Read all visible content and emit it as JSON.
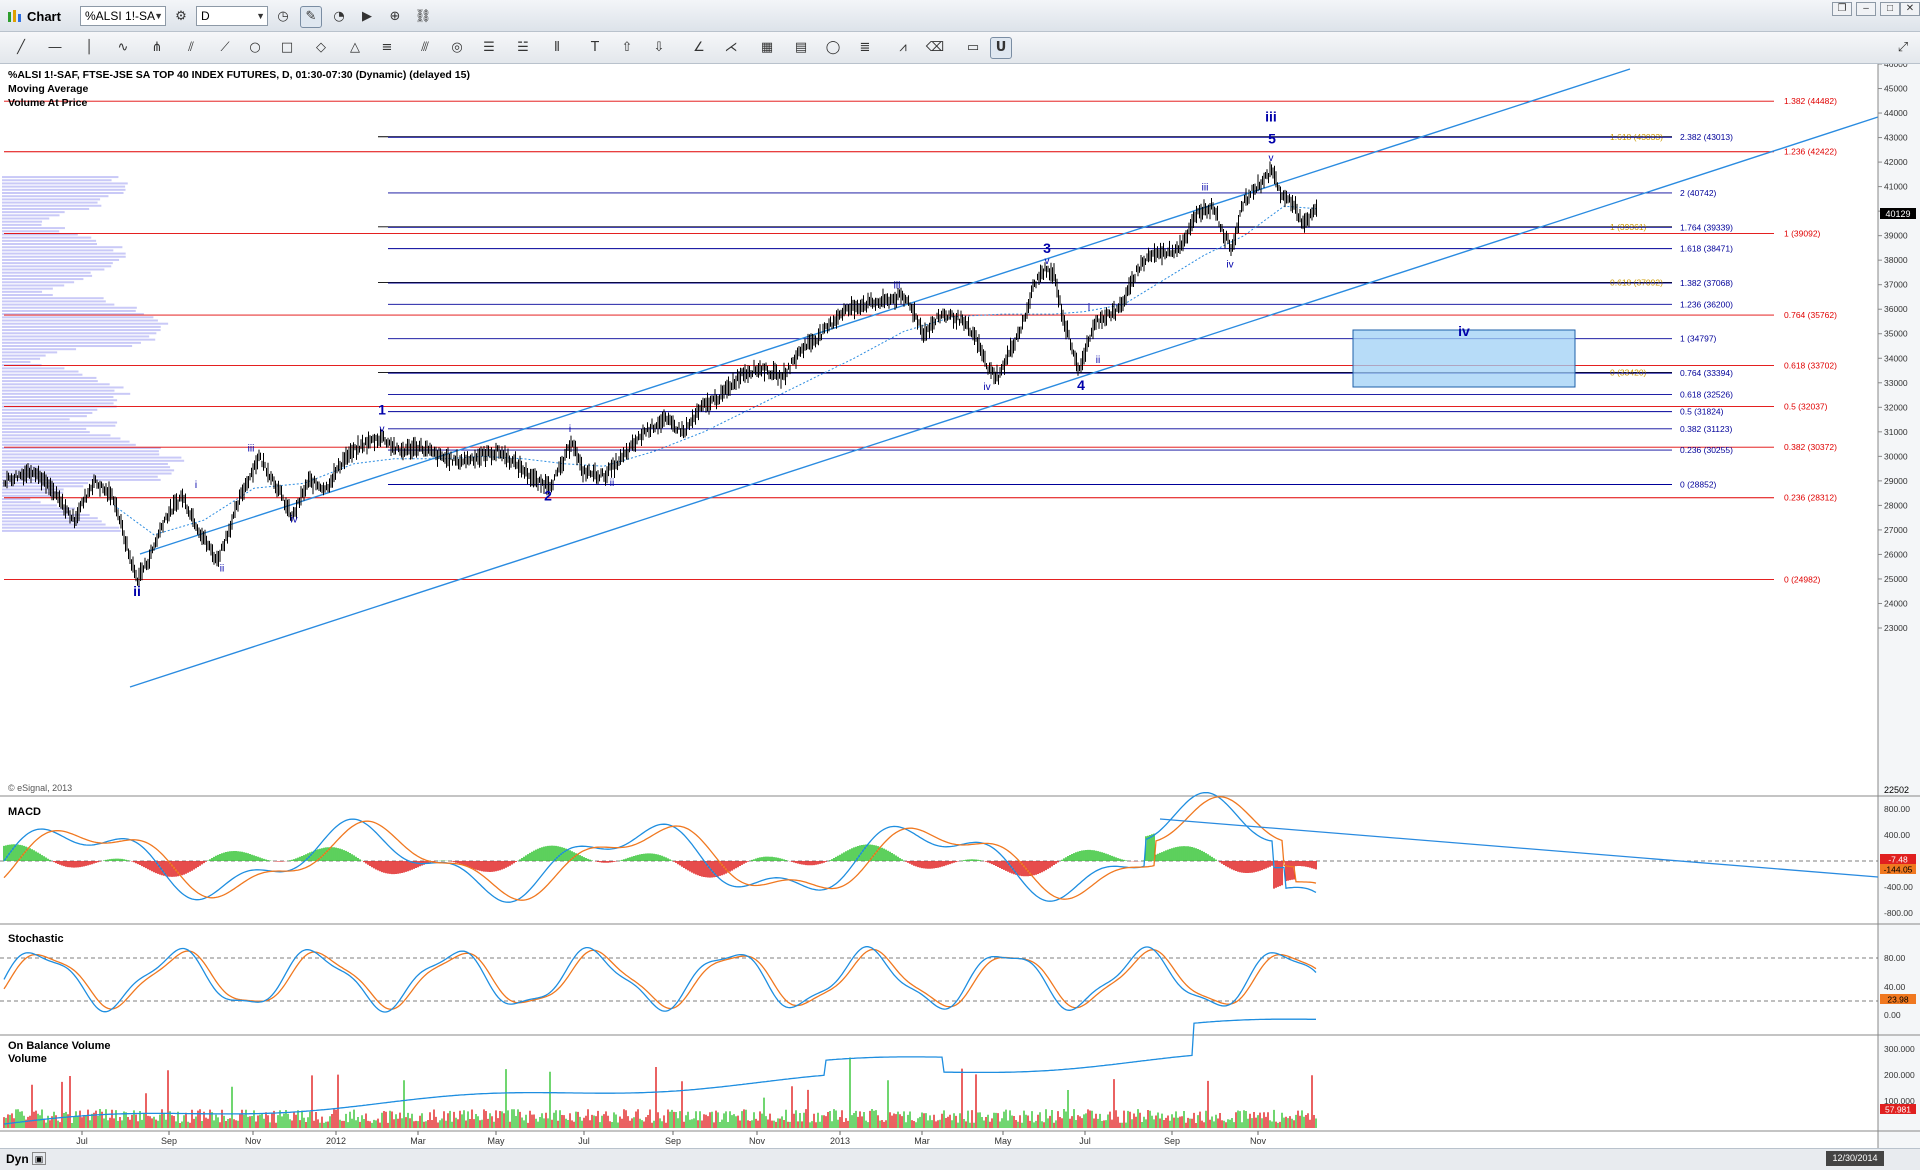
{
  "window": {
    "title": "Chart",
    "symbol": "%ALSI 1!-SA",
    "interval": "D"
  },
  "chart_info": {
    "line1": "%ALSI 1!-SAF, FTSE-JSE SA TOP 40 INDEX FUTURES, D, 01:30-07:30 (Dynamic) (delayed 15)",
    "line2": "Moving Average",
    "line3": "Volume At Price"
  },
  "copyright": "© eSignal, 2013",
  "statusbar": {
    "left": "Dyn",
    "date_box": "12/30/2014"
  },
  "colors": {
    "price": "#000000",
    "macd_line": "#1e8ee0",
    "signal_line": "#f07820",
    "hist_up": "#34c434",
    "hist_down": "#e02020",
    "fib_red": "#e00000",
    "fib_blue": "#000099",
    "fib_gold": "#cc9900",
    "channel": "#2a8be0",
    "box_fill": "#9fd0f5"
  },
  "chart_data": {
    "type": "line",
    "title": "",
    "x_ticks": [
      "Jul",
      "Sep",
      "Nov",
      "2012",
      "Mar",
      "May",
      "Jul",
      "Sep",
      "Nov",
      "2013",
      "Mar",
      "May",
      "Jul",
      "Sep",
      "Nov"
    ],
    "price_axis": {
      "ylim": [
        22000,
        46500
      ],
      "ticks": [
        "46000",
        "45000",
        "44000",
        "43000",
        "42000",
        "41000",
        "40000",
        "39000",
        "38000",
        "37000",
        "36000",
        "35000",
        "34000",
        "33000",
        "32000",
        "31000",
        "30000",
        "29000",
        "28000",
        "27000",
        "26000",
        "25000",
        "24000",
        "23000"
      ],
      "last_value": "40129",
      "bottom_value": "22502"
    },
    "price_series": [
      [
        0,
        29000
      ],
      [
        30,
        29450
      ],
      [
        50,
        28500
      ],
      [
        70,
        27400
      ],
      [
        90,
        29000
      ],
      [
        110,
        28300
      ],
      [
        125,
        26000
      ],
      [
        133,
        24980
      ],
      [
        145,
        25800
      ],
      [
        160,
        27400
      ],
      [
        178,
        28400
      ],
      [
        195,
        27000
      ],
      [
        213,
        25750
      ],
      [
        225,
        27000
      ],
      [
        238,
        28500
      ],
      [
        255,
        30000
      ],
      [
        270,
        29000
      ],
      [
        288,
        27500
      ],
      [
        305,
        29000
      ],
      [
        322,
        28700
      ],
      [
        340,
        29900
      ],
      [
        360,
        30500
      ],
      [
        378,
        30800
      ],
      [
        395,
        30200
      ],
      [
        415,
        30400
      ],
      [
        435,
        30000
      ],
      [
        455,
        29800
      ],
      [
        475,
        30000
      ],
      [
        495,
        30200
      ],
      [
        515,
        29600
      ],
      [
        535,
        28900
      ],
      [
        548,
        28900
      ],
      [
        560,
        29800
      ],
      [
        568,
        30700
      ],
      [
        578,
        29400
      ],
      [
        600,
        29200
      ],
      [
        620,
        30000
      ],
      [
        640,
        31000
      ],
      [
        660,
        31500
      ],
      [
        680,
        31000
      ],
      [
        698,
        32000
      ],
      [
        718,
        32500
      ],
      [
        738,
        33400
      ],
      [
        758,
        33600
      ],
      [
        778,
        33200
      ],
      [
        798,
        34400
      ],
      [
        818,
        35000
      ],
      [
        838,
        35900
      ],
      [
        858,
        36200
      ],
      [
        878,
        36300
      ],
      [
        896,
        36500
      ],
      [
        905,
        36300
      ],
      [
        920,
        35000
      ],
      [
        938,
        35800
      ],
      [
        956,
        35600
      ],
      [
        972,
        34800
      ],
      [
        985,
        33500
      ],
      [
        995,
        33250
      ],
      [
        1005,
        34200
      ],
      [
        1020,
        35500
      ],
      [
        1030,
        37000
      ],
      [
        1040,
        37600
      ],
      [
        1050,
        37400
      ],
      [
        1060,
        35500
      ],
      [
        1068,
        34500
      ],
      [
        1076,
        33400
      ],
      [
        1083,
        34600
      ],
      [
        1093,
        35500
      ],
      [
        1103,
        35800
      ],
      [
        1113,
        35900
      ],
      [
        1123,
        36600
      ],
      [
        1133,
        37600
      ],
      [
        1145,
        38200
      ],
      [
        1158,
        38300
      ],
      [
        1170,
        38400
      ],
      [
        1180,
        38800
      ],
      [
        1195,
        40000
      ],
      [
        1210,
        40200
      ],
      [
        1220,
        39000
      ],
      [
        1228,
        38500
      ],
      [
        1238,
        40200
      ],
      [
        1248,
        40800
      ],
      [
        1258,
        41200
      ],
      [
        1268,
        41650
      ],
      [
        1278,
        40600
      ],
      [
        1288,
        40400
      ],
      [
        1300,
        39400
      ],
      [
        1313,
        40129
      ]
    ],
    "moving_average": [
      [
        110,
        28000
      ],
      [
        150,
        26800
      ],
      [
        200,
        27400
      ],
      [
        250,
        28700
      ],
      [
        300,
        28900
      ],
      [
        350,
        29700
      ],
      [
        390,
        29900
      ],
      [
        440,
        29900
      ],
      [
        480,
        30000
      ],
      [
        520,
        29900
      ],
      [
        560,
        29700
      ],
      [
        600,
        29600
      ],
      [
        650,
        30200
      ],
      [
        700,
        31000
      ],
      [
        750,
        32000
      ],
      [
        800,
        33000
      ],
      [
        850,
        34000
      ],
      [
        900,
        35100
      ],
      [
        950,
        35700
      ],
      [
        1000,
        35800
      ],
      [
        1050,
        35800
      ],
      [
        1080,
        35900
      ],
      [
        1120,
        36200
      ],
      [
        1160,
        37200
      ],
      [
        1200,
        38200
      ],
      [
        1240,
        39000
      ],
      [
        1280,
        40200
      ],
      [
        1313,
        40100
      ]
    ],
    "horizontal_levels": [
      {
        "label": "1.382 (44482)",
        "price": 44482,
        "color": "red"
      },
      {
        "label": "1.618 (43033)",
        "price": 43033,
        "color": "gold"
      },
      {
        "label": "2.382 (43013)",
        "price": 43013,
        "color": "blue"
      },
      {
        "label": "1.236 (42422)",
        "price": 42422,
        "color": "red"
      },
      {
        "label": "2 (40742)",
        "price": 40742,
        "color": "blue"
      },
      {
        "label": "1 (39361)",
        "price": 39361,
        "color": "gold"
      },
      {
        "label": "1.764 (39339)",
        "price": 39339,
        "color": "blue"
      },
      {
        "label": "1 (39092)",
        "price": 39092,
        "color": "red"
      },
      {
        "label": "1.618 (38471)",
        "price": 38471,
        "color": "blue"
      },
      {
        "label": "0.618 (37092)",
        "price": 37092,
        "color": "gold"
      },
      {
        "label": "1.382 (37068)",
        "price": 37068,
        "color": "blue"
      },
      {
        "label": "1.236 (36200)",
        "price": 36200,
        "color": "blue"
      },
      {
        "label": "0.764 (35762)",
        "price": 35762,
        "color": "red"
      },
      {
        "label": "1 (34797)",
        "price": 34797,
        "color": "blue"
      },
      {
        "label": "0.618 (33702)",
        "price": 33702,
        "color": "red"
      },
      {
        "label": "0 (33420)",
        "price": 33420,
        "color": "gold"
      },
      {
        "label": "0.764 (33394)",
        "price": 33394,
        "color": "blue"
      },
      {
        "label": "0.618 (32526)",
        "price": 32526,
        "color": "blue"
      },
      {
        "label": "0.5 (32037)",
        "price": 32037,
        "color": "red"
      },
      {
        "label": "0.5 (31824)",
        "price": 31824,
        "color": "blue"
      },
      {
        "label": "0.382 (31123)",
        "price": 31123,
        "color": "blue"
      },
      {
        "label": "0.382 (30372)",
        "price": 30372,
        "color": "red"
      },
      {
        "label": "0.236 (30255)",
        "price": 30255,
        "color": "blue"
      },
      {
        "label": "0 (28852)",
        "price": 28852,
        "color": "blue"
      },
      {
        "label": "0.236 (28312)",
        "price": 28312,
        "color": "red"
      },
      {
        "label": "0 (24982)",
        "price": 24982,
        "color": "red"
      }
    ],
    "wave_labels": [
      {
        "text": "ii",
        "bar": 133,
        "price": 24300,
        "big": true
      },
      {
        "text": "1",
        "bar": 378,
        "price": 31700,
        "big": true
      },
      {
        "text": "2",
        "bar": 544,
        "price": 28200,
        "big": true
      },
      {
        "text": "3",
        "bar": 1043,
        "price": 38300,
        "big": true
      },
      {
        "text": "4",
        "bar": 1077,
        "price": 32700,
        "big": true
      },
      {
        "text": "5",
        "bar": 1268,
        "price": 42750,
        "big": true
      },
      {
        "text": "iii",
        "bar": 1267,
        "price": 43650,
        "big": true
      },
      {
        "text": "iv",
        "bar": 1460,
        "price": 34900,
        "big": true
      },
      {
        "text": "i",
        "bar": 192,
        "price": 28700,
        "big": false
      },
      {
        "text": "ii",
        "bar": 218,
        "price": 25300,
        "big": false
      },
      {
        "text": "iii",
        "bar": 247,
        "price": 30200,
        "big": false
      },
      {
        "text": "iv",
        "bar": 290,
        "price": 27300,
        "big": false
      },
      {
        "text": "v",
        "bar": 378,
        "price": 31000,
        "big": false
      },
      {
        "text": "i",
        "bar": 566,
        "price": 31000,
        "big": false
      },
      {
        "text": "ii",
        "bar": 608,
        "price": 28800,
        "big": false
      },
      {
        "text": "iii",
        "bar": 893,
        "price": 36850,
        "big": false
      },
      {
        "text": "iv",
        "bar": 983,
        "price": 32700,
        "big": false
      },
      {
        "text": "v",
        "bar": 1043,
        "price": 37850,
        "big": false
      },
      {
        "text": "i",
        "bar": 1085,
        "price": 35950,
        "big": false
      },
      {
        "text": "ii",
        "bar": 1094,
        "price": 33800,
        "big": false
      },
      {
        "text": "iii",
        "bar": 1201,
        "price": 40850,
        "big": false
      },
      {
        "text": "iv",
        "bar": 1226,
        "price": 37700,
        "big": false
      },
      {
        "text": "v",
        "bar": 1267,
        "price": 42050,
        "big": false
      }
    ],
    "macd": {
      "label": "MACD",
      "ylim": [
        -1000,
        950
      ],
      "ticks": [
        "800.00",
        "400.00",
        "0.00",
        "-400.00",
        "-800.00"
      ],
      "value_macd": "-7.48",
      "value_signal": "-144.05"
    },
    "stochastic": {
      "label": "Stochastic",
      "ylim": [
        -12,
        112
      ],
      "ticks": [
        "80.00",
        "40.00",
        "0.00"
      ],
      "value": "23.98",
      "levels": [
        80,
        20
      ]
    },
    "obv": {
      "label": "On Balance Volume",
      "sublabel": "Volume",
      "ticks": [
        "300.000",
        "200.000",
        "100.000"
      ],
      "value": "57.981"
    }
  }
}
